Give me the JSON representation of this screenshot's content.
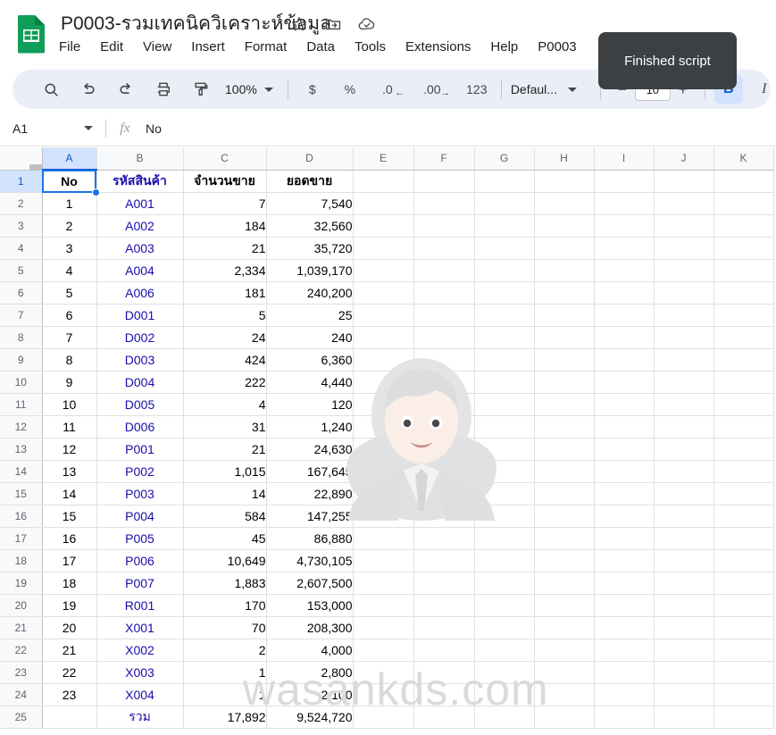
{
  "app": {
    "logo_icon": "sheets-icon",
    "doc_title": "P0003-รวมเทคนิควิเคราะห์ข้อมูล",
    "title_icons": [
      "star-icon",
      "move-to-folder-icon",
      "cloud-saved-icon"
    ]
  },
  "menubar": {
    "items": [
      {
        "label": "File"
      },
      {
        "label": "Edit"
      },
      {
        "label": "View"
      },
      {
        "label": "Insert"
      },
      {
        "label": "Format"
      },
      {
        "label": "Data"
      },
      {
        "label": "Tools"
      },
      {
        "label": "Extensions"
      },
      {
        "label": "Help"
      },
      {
        "label": "P0003"
      }
    ]
  },
  "tooltip": {
    "text": "Finished script",
    "bg": "#3c4043"
  },
  "toolbar": {
    "search_icon": "search-icon",
    "undo_icon": "undo-icon",
    "redo_icon": "redo-icon",
    "print_icon": "print-icon",
    "paint_format_icon": "paint-format-icon",
    "zoom_value": "100%",
    "currency_label": "$",
    "percent_label": "%",
    "decimal_decrease_label": ".0",
    "decimal_increase_label": ".00",
    "more_formats_label": "123",
    "font_name": "Defaul...",
    "font_size": "10",
    "decrease_font_label": "−",
    "increase_font_label": "+",
    "bold_label": "B",
    "italic_label": "I",
    "strikethrough_icon": "strikethrough-icon",
    "bold_active_bg": "#d3e3fd",
    "bold_active_color": "#0b57d0"
  },
  "formula_bar": {
    "name_box": "A1",
    "fx_label": "fx",
    "value": "No"
  },
  "grid": {
    "columns": [
      "A",
      "B",
      "C",
      "D",
      "E",
      "F",
      "G",
      "H",
      "I",
      "J",
      "K"
    ],
    "selected_column": "A",
    "selected_row": "1",
    "selected_cell": "A1",
    "rows": [
      {
        "n": "1",
        "a": "No",
        "b": "รหัสสินค้า",
        "c": "จำนวนขาย",
        "d": "ยอดขาย"
      },
      {
        "n": "2",
        "a": "1",
        "b": "A001",
        "c": "7",
        "d": "7,540"
      },
      {
        "n": "3",
        "a": "2",
        "b": "A002",
        "c": "184",
        "d": "32,560"
      },
      {
        "n": "4",
        "a": "3",
        "b": "A003",
        "c": "21",
        "d": "35,720"
      },
      {
        "n": "5",
        "a": "4",
        "b": "A004",
        "c": "2,334",
        "d": "1,039,170"
      },
      {
        "n": "6",
        "a": "5",
        "b": "A006",
        "c": "181",
        "d": "240,200"
      },
      {
        "n": "7",
        "a": "6",
        "b": "D001",
        "c": "5",
        "d": "25"
      },
      {
        "n": "8",
        "a": "7",
        "b": "D002",
        "c": "24",
        "d": "240"
      },
      {
        "n": "9",
        "a": "8",
        "b": "D003",
        "c": "424",
        "d": "6,360"
      },
      {
        "n": "10",
        "a": "9",
        "b": "D004",
        "c": "222",
        "d": "4,440"
      },
      {
        "n": "11",
        "a": "10",
        "b": "D005",
        "c": "4",
        "d": "120"
      },
      {
        "n": "12",
        "a": "11",
        "b": "D006",
        "c": "31",
        "d": "1,240"
      },
      {
        "n": "13",
        "a": "12",
        "b": "P001",
        "c": "21",
        "d": "24,630"
      },
      {
        "n": "14",
        "a": "13",
        "b": "P002",
        "c": "1,015",
        "d": "167,645"
      },
      {
        "n": "15",
        "a": "14",
        "b": "P003",
        "c": "14",
        "d": "22,890"
      },
      {
        "n": "16",
        "a": "15",
        "b": "P004",
        "c": "584",
        "d": "147,255"
      },
      {
        "n": "17",
        "a": "16",
        "b": "P005",
        "c": "45",
        "d": "86,880"
      },
      {
        "n": "18",
        "a": "17",
        "b": "P006",
        "c": "10,649",
        "d": "4,730,105"
      },
      {
        "n": "19",
        "a": "18",
        "b": "P007",
        "c": "1,883",
        "d": "2,607,500"
      },
      {
        "n": "20",
        "a": "19",
        "b": "R001",
        "c": "170",
        "d": "153,000"
      },
      {
        "n": "21",
        "a": "20",
        "b": "X001",
        "c": "70",
        "d": "208,300"
      },
      {
        "n": "22",
        "a": "21",
        "b": "X002",
        "c": "2",
        "d": "4,000"
      },
      {
        "n": "23",
        "a": "22",
        "b": "X003",
        "c": "1",
        "d": "2,800"
      },
      {
        "n": "24",
        "a": "23",
        "b": "X004",
        "c": "1",
        "d": "2,100"
      },
      {
        "n": "25",
        "a": "",
        "b": "รวม",
        "c": "17,892",
        "d": "9,524,720"
      }
    ]
  },
  "watermark": {
    "text": "wasankds.com",
    "color": "#d9dadb",
    "avatar_icon": "person-avatar-icon"
  },
  "colors": {
    "sheets_green": "#0f9d58",
    "accent_blue": "#1a73e8",
    "cell_blue_text": "#1a0dab",
    "toolbar_bg": "#eaeef6",
    "header_bg": "#f8f9fa"
  }
}
